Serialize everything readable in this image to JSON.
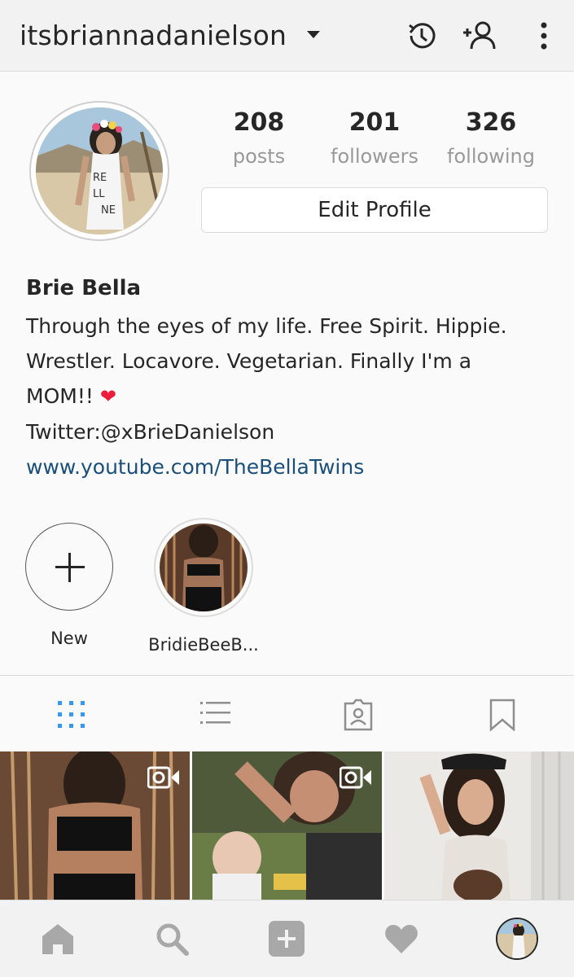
{
  "header": {
    "username": "itsbriannadanielson",
    "icons": [
      "chevron-down-icon",
      "history-icon",
      "add-user-icon",
      "more-icon"
    ]
  },
  "profile": {
    "stats": {
      "posts_count": "208",
      "posts_label": "posts",
      "followers_count": "201",
      "followers_label": "followers",
      "following_count": "326",
      "following_label": "following"
    },
    "edit_button": "Edit Profile",
    "name": "Brie Bella",
    "bio_line1": "Through the eyes of my life. Free Spirit. Hippie.",
    "bio_line2": "Wrestler. Locavore. Vegetarian. Finally I'm a",
    "bio_line3": "MOM!!",
    "bio_heart": "❤",
    "twitter": "Twitter:@xBrieDanielson",
    "website": "www.youtube.com/TheBellaTwins"
  },
  "highlights": [
    {
      "label": "New"
    },
    {
      "label": "BridieBeeB..."
    }
  ],
  "tabs": [
    "grid-icon",
    "list-icon",
    "tagged-icon",
    "bookmark-icon"
  ],
  "bottom_nav": [
    "home-icon",
    "search-icon",
    "add-icon",
    "heart-icon",
    "profile-avatar"
  ],
  "colors": {
    "accent_blue": "#3897f0",
    "link": "#1b4f7a",
    "heart": "#ed1c3a",
    "muted": "#999999"
  }
}
